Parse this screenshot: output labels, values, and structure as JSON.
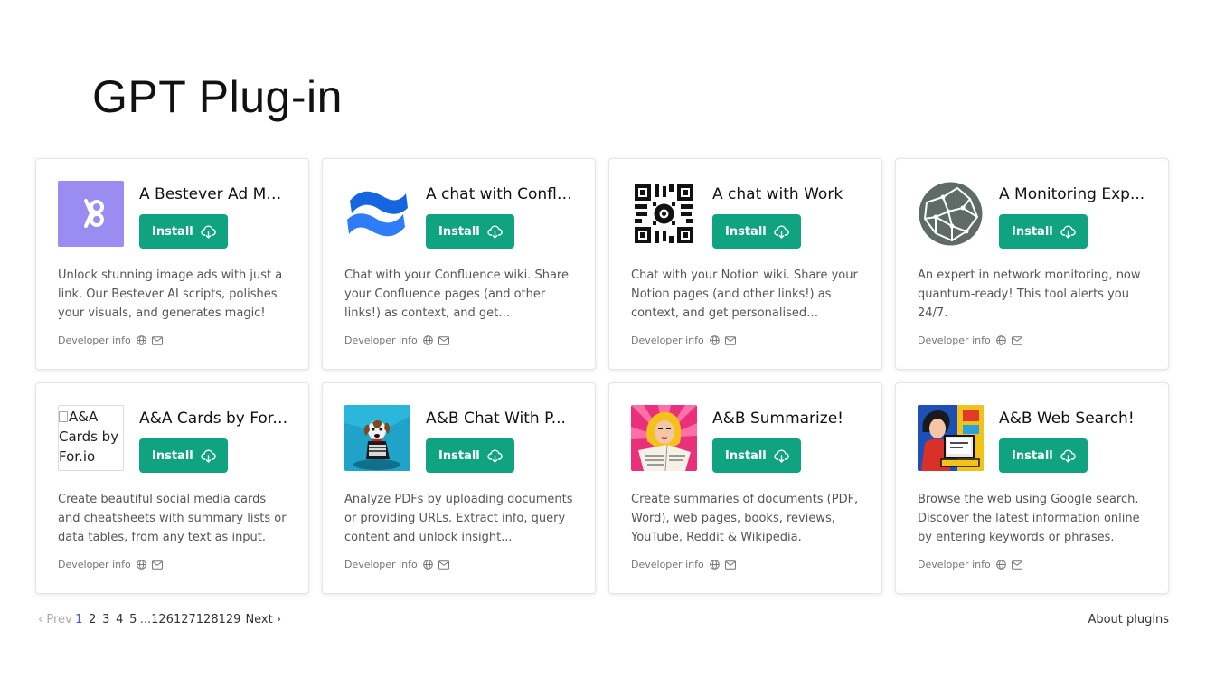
{
  "title": "GPT Plug-in",
  "install_label": "Install",
  "developer_info_label": "Developer info",
  "plugins": [
    {
      "name": "A Bestever Ad Ma...",
      "logo_icon": "bestever-logo-icon",
      "description": "Unlock stunning image ads with just a link. Our Bestever AI scripts, polishes your visuals, and generates magic!"
    },
    {
      "name": "A chat with Conflu...",
      "logo_icon": "confluence-logo-icon",
      "description": "Chat with your Confluence wiki. Share your Confluence pages (and other links!) as context, and get personalise..."
    },
    {
      "name": "A chat with Work",
      "logo_icon": "qr-logo-icon",
      "description": "Chat with your Notion wiki. Share your Notion pages (and other links!) as context, and get personalised answers."
    },
    {
      "name": "A Monitoring Exp...",
      "logo_icon": "network-logo-icon",
      "description": "An expert in network monitoring, now quantum-ready! This tool alerts you 24/7."
    },
    {
      "name": "A&A Cards by For....",
      "logo_icon": "broken-image-icon",
      "logo_alt": "A&A Cards by For.io",
      "description": "Create beautiful social media cards and cheatsheets with summary lists or data tables, from any text as input."
    },
    {
      "name": "A&B Chat With P...",
      "logo_icon": "dog-logo-icon",
      "description": "Analyze PDFs by uploading documents or providing URLs. Extract info, query content and unlock insight..."
    },
    {
      "name": "A&B Summarize!",
      "logo_icon": "popart-reader-logo-icon",
      "description": "Create summaries of documents (PDF, Word), web pages, books, reviews, YouTube, Reddit & Wikipedia."
    },
    {
      "name": "A&B Web Search!",
      "logo_icon": "popart-computer-logo-icon",
      "description": "Browse the web using Google search. Discover the latest information online by entering keywords or phrases."
    }
  ],
  "pagination": {
    "prev": "Prev",
    "pages": [
      "1",
      "2",
      "3",
      "4",
      "5"
    ],
    "ellipsis": "...",
    "last_pages": [
      "126",
      "127",
      "128",
      "129"
    ],
    "next": "Next",
    "active": "1"
  },
  "about_link": "About plugins",
  "colors": {
    "accent": "#10a37f",
    "active_page": "#3b5bdb"
  }
}
